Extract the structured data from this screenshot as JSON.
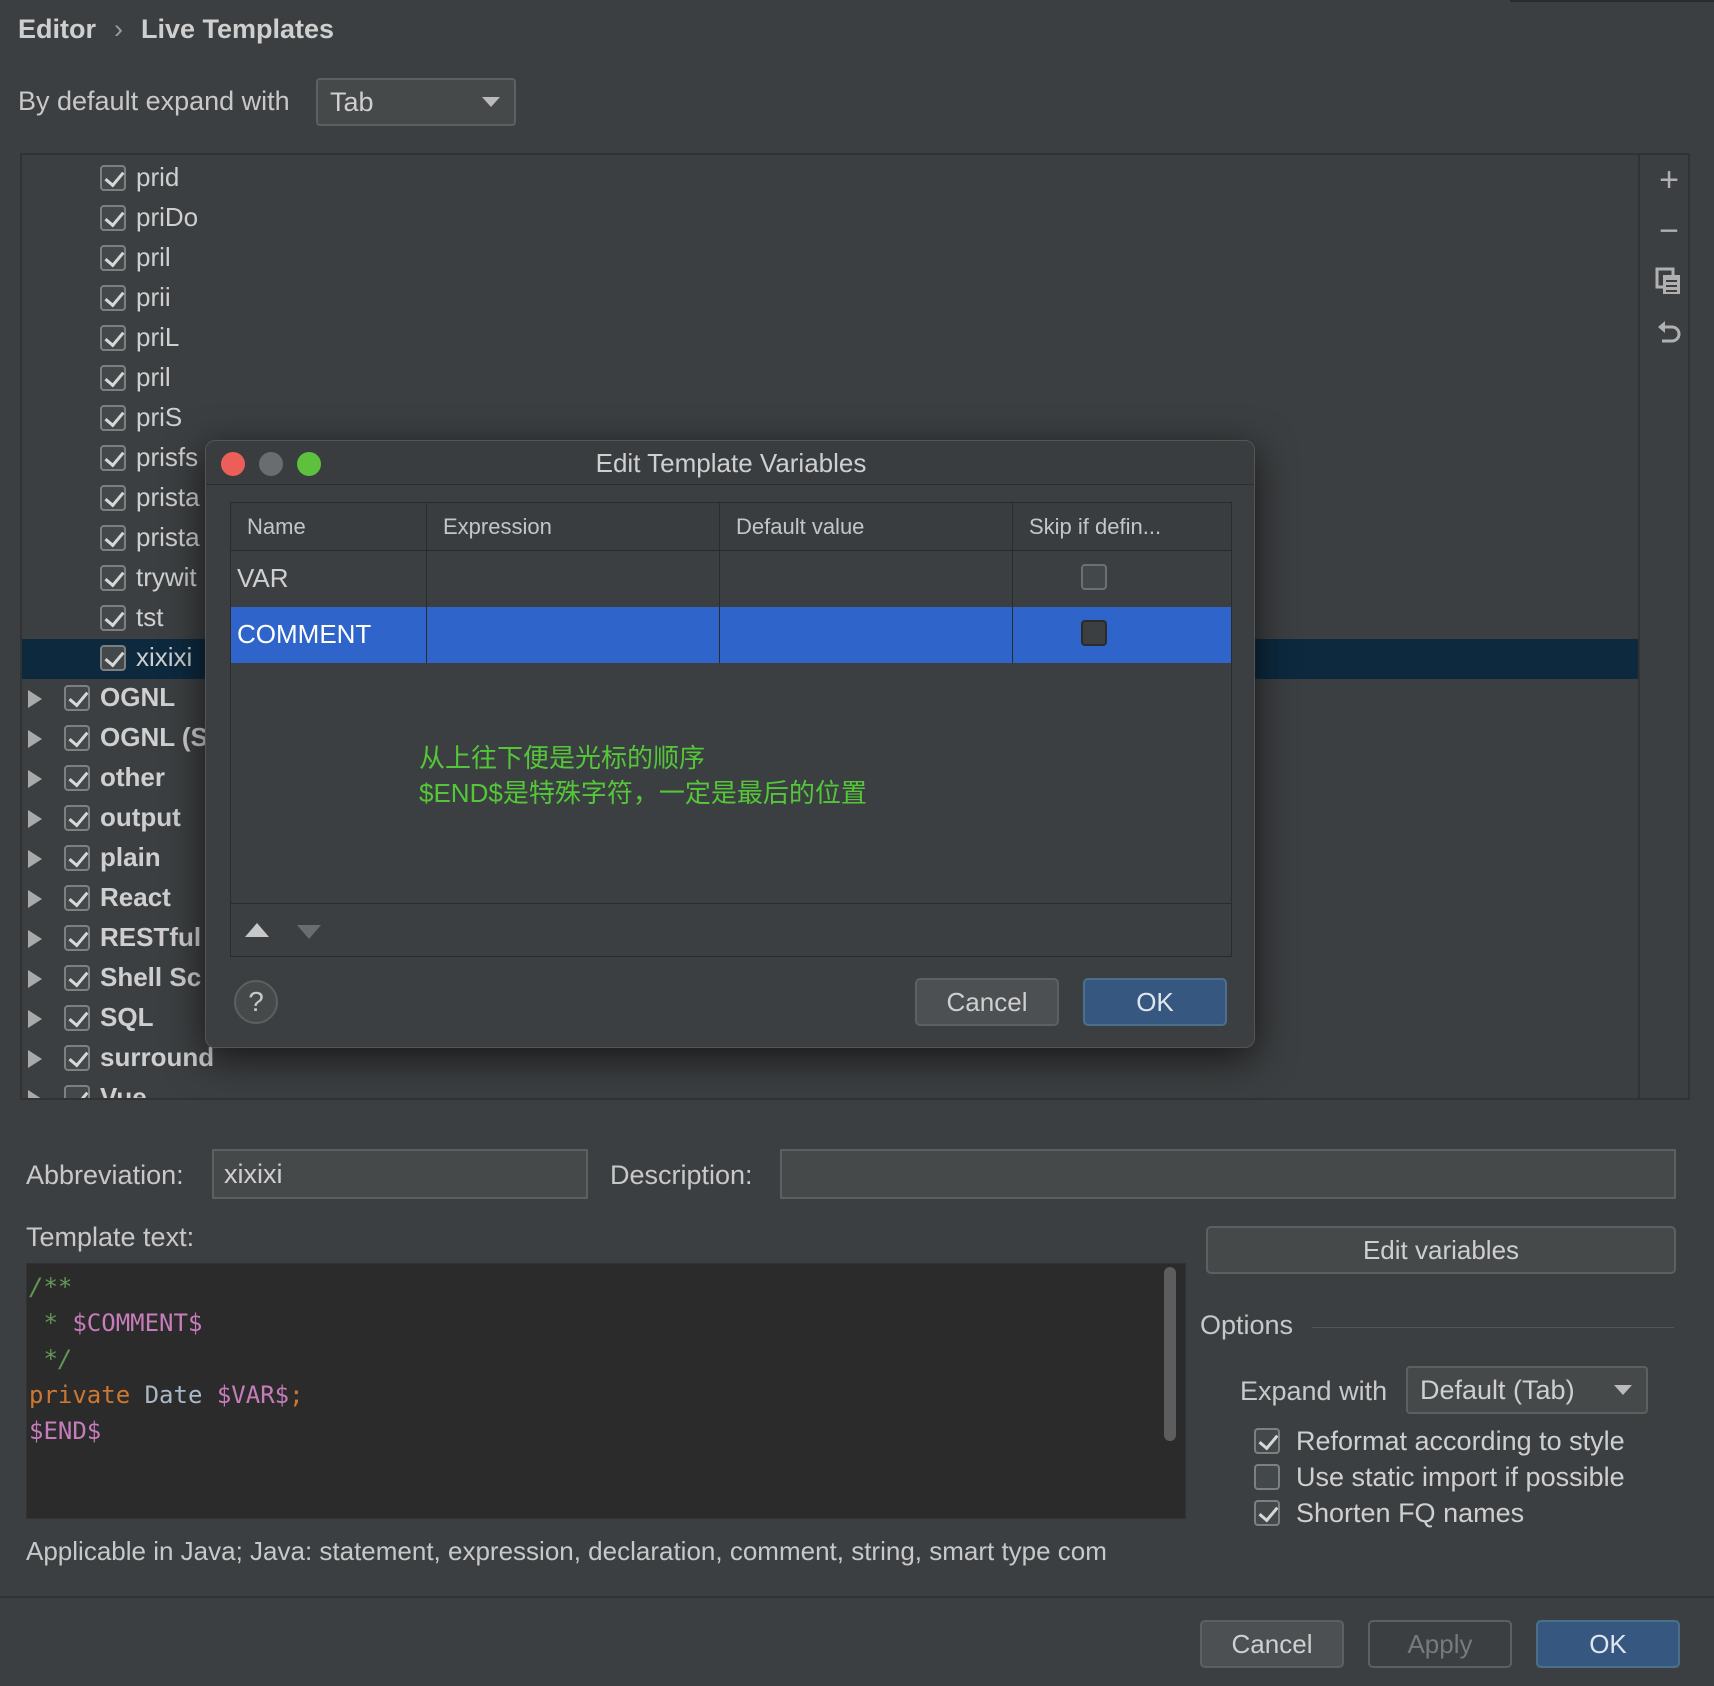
{
  "breadcrumb": {
    "parent": "Editor",
    "separator": "›",
    "current": "Live Templates"
  },
  "expand_default": {
    "label": "By default expand with",
    "value": "Tab"
  },
  "tree": {
    "templates": [
      {
        "label": "prid",
        "checked": true
      },
      {
        "label": "priDo",
        "checked": true
      },
      {
        "label": "pril",
        "checked": true
      },
      {
        "label": "prii",
        "checked": true
      },
      {
        "label": "priL",
        "checked": true
      },
      {
        "label": "pril",
        "checked": true
      },
      {
        "label": "priS",
        "checked": true
      },
      {
        "label": "prisfs",
        "checked": true
      },
      {
        "label": "prista",
        "checked": true
      },
      {
        "label": "prista",
        "checked": true
      },
      {
        "label": "trywit",
        "checked": true
      },
      {
        "label": "tst",
        "checked": true
      },
      {
        "label": "xixixi",
        "checked": true,
        "selected": true
      }
    ],
    "groups": [
      {
        "label": "OGNL",
        "checked": true
      },
      {
        "label": "OGNL (S",
        "checked": true
      },
      {
        "label": "other",
        "checked": true
      },
      {
        "label": "output",
        "checked": true
      },
      {
        "label": "plain",
        "checked": true
      },
      {
        "label": "React",
        "checked": true
      },
      {
        "label": "RESTful",
        "checked": true
      },
      {
        "label": "Shell Sc",
        "checked": true
      },
      {
        "label": "SQL",
        "checked": true
      },
      {
        "label": "surround",
        "checked": true
      },
      {
        "label": "Vue",
        "checked": true
      }
    ]
  },
  "toolbar": {
    "add": "+",
    "remove": "−",
    "copy": "copy-icon",
    "restore": "undo-icon"
  },
  "dialog": {
    "title": "Edit Template Variables",
    "columns": [
      "Name",
      "Expression",
      "Default value",
      "Skip if defin..."
    ],
    "rows": [
      {
        "name": "VAR",
        "expression": "",
        "default": "",
        "skip": false,
        "selected": false
      },
      {
        "name": "COMMENT",
        "expression": "",
        "default": "",
        "skip": false,
        "selected": true
      }
    ],
    "note_line1": "从上往下便是光标的顺序",
    "note_line2": "$END$是特殊字符，一定是最后的位置",
    "help_label": "?",
    "cancel_label": "Cancel",
    "ok_label": "OK"
  },
  "abbreviation": {
    "label": "Abbreviation:",
    "value": "xixixi"
  },
  "description": {
    "label": "Description:",
    "value": ""
  },
  "template_text": {
    "label": "Template text:",
    "line1": "/**",
    "line2_prefix": " * ",
    "line2_var": "$COMMENT$",
    "line3": " */",
    "line4_kw": "private",
    "line4_type": " Date ",
    "line4_var": "$VAR$",
    "line4_end": ";",
    "line5": "$END$"
  },
  "edit_variables_label": "Edit variables",
  "options": {
    "title": "Options",
    "expand_label": "Expand with",
    "expand_value": "Default (Tab)",
    "items": [
      {
        "label": "Reformat according to style",
        "checked": true
      },
      {
        "label": "Use static import if possible",
        "checked": false
      },
      {
        "label": "Shorten FQ names",
        "checked": true
      }
    ]
  },
  "applicable": "Applicable in Java; Java: statement, expression, declaration, comment, string, smart type com",
  "footer": {
    "cancel_label": "Cancel",
    "apply_label": "Apply",
    "ok_label": "OK"
  },
  "colors": {
    "accent": "#2f65ca",
    "selection_dark": "#0d293e",
    "note_green": "#54c739",
    "primary_button": "#365880"
  }
}
